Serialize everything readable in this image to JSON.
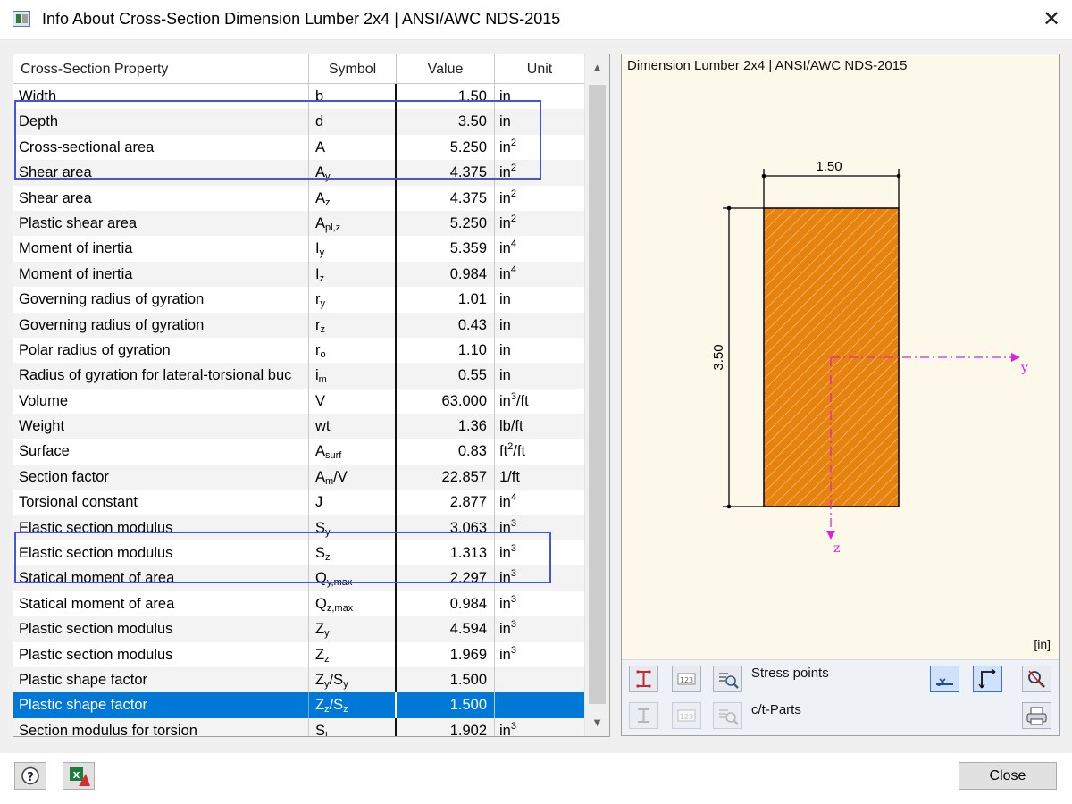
{
  "window": {
    "title": "Info About Cross-Section Dimension Lumber 2x4 | ANSI/AWC NDS-2015",
    "close_glyph": "✕"
  },
  "table": {
    "headers": {
      "property": "Cross-Section Property",
      "symbol": "Symbol",
      "value": "Value",
      "unit": "Unit"
    },
    "rows": [
      {
        "property": "Width",
        "sym": "b",
        "sym_sub": "",
        "sym_rest": "",
        "value": "1.50",
        "unit": "in",
        "unit_sup": "",
        "unit_rest": ""
      },
      {
        "property": "Depth",
        "sym": "d",
        "sym_sub": "",
        "sym_rest": "",
        "value": "3.50",
        "unit": "in",
        "unit_sup": "",
        "unit_rest": ""
      },
      {
        "property": "Cross-sectional area",
        "sym": "A",
        "sym_sub": "",
        "sym_rest": "",
        "value": "5.250",
        "unit": "in",
        "unit_sup": "2",
        "unit_rest": ""
      },
      {
        "property": "Shear area",
        "sym": "A",
        "sym_sub": "y",
        "sym_rest": "",
        "value": "4.375",
        "unit": "in",
        "unit_sup": "2",
        "unit_rest": ""
      },
      {
        "property": "Shear area",
        "sym": "A",
        "sym_sub": "z",
        "sym_rest": "",
        "value": "4.375",
        "unit": "in",
        "unit_sup": "2",
        "unit_rest": ""
      },
      {
        "property": "Plastic shear area",
        "sym": "A",
        "sym_sub": "pl,z",
        "sym_rest": "",
        "value": "5.250",
        "unit": "in",
        "unit_sup": "2",
        "unit_rest": ""
      },
      {
        "property": "Moment of inertia",
        "sym": "I",
        "sym_sub": "y",
        "sym_rest": "",
        "value": "5.359",
        "unit": "in",
        "unit_sup": "4",
        "unit_rest": ""
      },
      {
        "property": "Moment of inertia",
        "sym": "I",
        "sym_sub": "z",
        "sym_rest": "",
        "value": "0.984",
        "unit": "in",
        "unit_sup": "4",
        "unit_rest": ""
      },
      {
        "property": "Governing radius of gyration",
        "sym": "r",
        "sym_sub": "y",
        "sym_rest": "",
        "value": "1.01",
        "unit": "in",
        "unit_sup": "",
        "unit_rest": ""
      },
      {
        "property": "Governing radius of gyration",
        "sym": "r",
        "sym_sub": "z",
        "sym_rest": "",
        "value": "0.43",
        "unit": "in",
        "unit_sup": "",
        "unit_rest": ""
      },
      {
        "property": "Polar radius of gyration",
        "sym": "r",
        "sym_sub": "o",
        "sym_rest": "",
        "value": "1.10",
        "unit": "in",
        "unit_sup": "",
        "unit_rest": ""
      },
      {
        "property": "Radius of gyration for lateral-torsional buc",
        "sym": "i",
        "sym_sub": "m",
        "sym_rest": "",
        "value": "0.55",
        "unit": "in",
        "unit_sup": "",
        "unit_rest": ""
      },
      {
        "property": "Volume",
        "sym": "V",
        "sym_sub": "",
        "sym_rest": "",
        "value": "63.000",
        "unit": "in",
        "unit_sup": "3",
        "unit_rest": "/ft"
      },
      {
        "property": "Weight",
        "sym": "wt",
        "sym_sub": "",
        "sym_rest": "",
        "value": "1.36",
        "unit": "lb/ft",
        "unit_sup": "",
        "unit_rest": ""
      },
      {
        "property": "Surface",
        "sym": "A",
        "sym_sub": "surf",
        "sym_rest": "",
        "value": "0.83",
        "unit": "ft",
        "unit_sup": "2",
        "unit_rest": "/ft"
      },
      {
        "property": "Section factor",
        "sym": "A",
        "sym_sub": "m",
        "sym_rest": "/V",
        "value": "22.857",
        "unit": "1/ft",
        "unit_sup": "",
        "unit_rest": ""
      },
      {
        "property": "Torsional constant",
        "sym": "J",
        "sym_sub": "",
        "sym_rest": "",
        "value": "2.877",
        "unit": "in",
        "unit_sup": "4",
        "unit_rest": ""
      },
      {
        "property": "Elastic section modulus",
        "sym": "S",
        "sym_sub": "y",
        "sym_rest": "",
        "value": "3.063",
        "unit": "in",
        "unit_sup": "3",
        "unit_rest": ""
      },
      {
        "property": "Elastic section modulus",
        "sym": "S",
        "sym_sub": "z",
        "sym_rest": "",
        "value": "1.313",
        "unit": "in",
        "unit_sup": "3",
        "unit_rest": ""
      },
      {
        "property": "Statical moment of area",
        "sym": "Q",
        "sym_sub": "y,max",
        "sym_rest": "",
        "value": "2.297",
        "unit": "in",
        "unit_sup": "3",
        "unit_rest": ""
      },
      {
        "property": "Statical moment of area",
        "sym": "Q",
        "sym_sub": "z,max",
        "sym_rest": "",
        "value": "0.984",
        "unit": "in",
        "unit_sup": "3",
        "unit_rest": ""
      },
      {
        "property": "Plastic section modulus",
        "sym": "Z",
        "sym_sub": "y",
        "sym_rest": "",
        "value": "4.594",
        "unit": "in",
        "unit_sup": "3",
        "unit_rest": ""
      },
      {
        "property": "Plastic section modulus",
        "sym": "Z",
        "sym_sub": "z",
        "sym_rest": "",
        "value": "1.969",
        "unit": "in",
        "unit_sup": "3",
        "unit_rest": ""
      },
      {
        "property": "Plastic shape factor",
        "sym": "Z",
        "sym_sub": "y",
        "sym_rest": "/S",
        "sym_sub2": "y",
        "value": "1.500",
        "unit": "",
        "unit_sup": "",
        "unit_rest": ""
      },
      {
        "property": "Plastic shape factor",
        "sym": "Z",
        "sym_sub": "z",
        "sym_rest": "/S",
        "sym_sub2": "z",
        "value": "1.500",
        "unit": "",
        "unit_sup": "",
        "unit_rest": "",
        "selected": true
      },
      {
        "property": "Section modulus for torsion",
        "sym": "S",
        "sym_sub": "t",
        "sym_rest": "",
        "value": "1.902",
        "unit": "in",
        "unit_sup": "3",
        "unit_rest": ""
      }
    ]
  },
  "graphic": {
    "title": "Dimension Lumber 2x4 | ANSI/AWC NDS-2015",
    "width_label": "1.50",
    "depth_label": "3.50",
    "axis_y": "y",
    "axis_z": "z",
    "unit_label": "[in]",
    "fill_color": "#e6820e",
    "axis_color": "#e020e0",
    "toolbar": {
      "stress_points_label": "Stress points",
      "ct_parts_label": "c/t-Parts"
    }
  },
  "footer": {
    "close_label": "Close"
  },
  "icons": {
    "help": "question-icon",
    "excel": "excel-export-icon",
    "print": "print-icon"
  }
}
